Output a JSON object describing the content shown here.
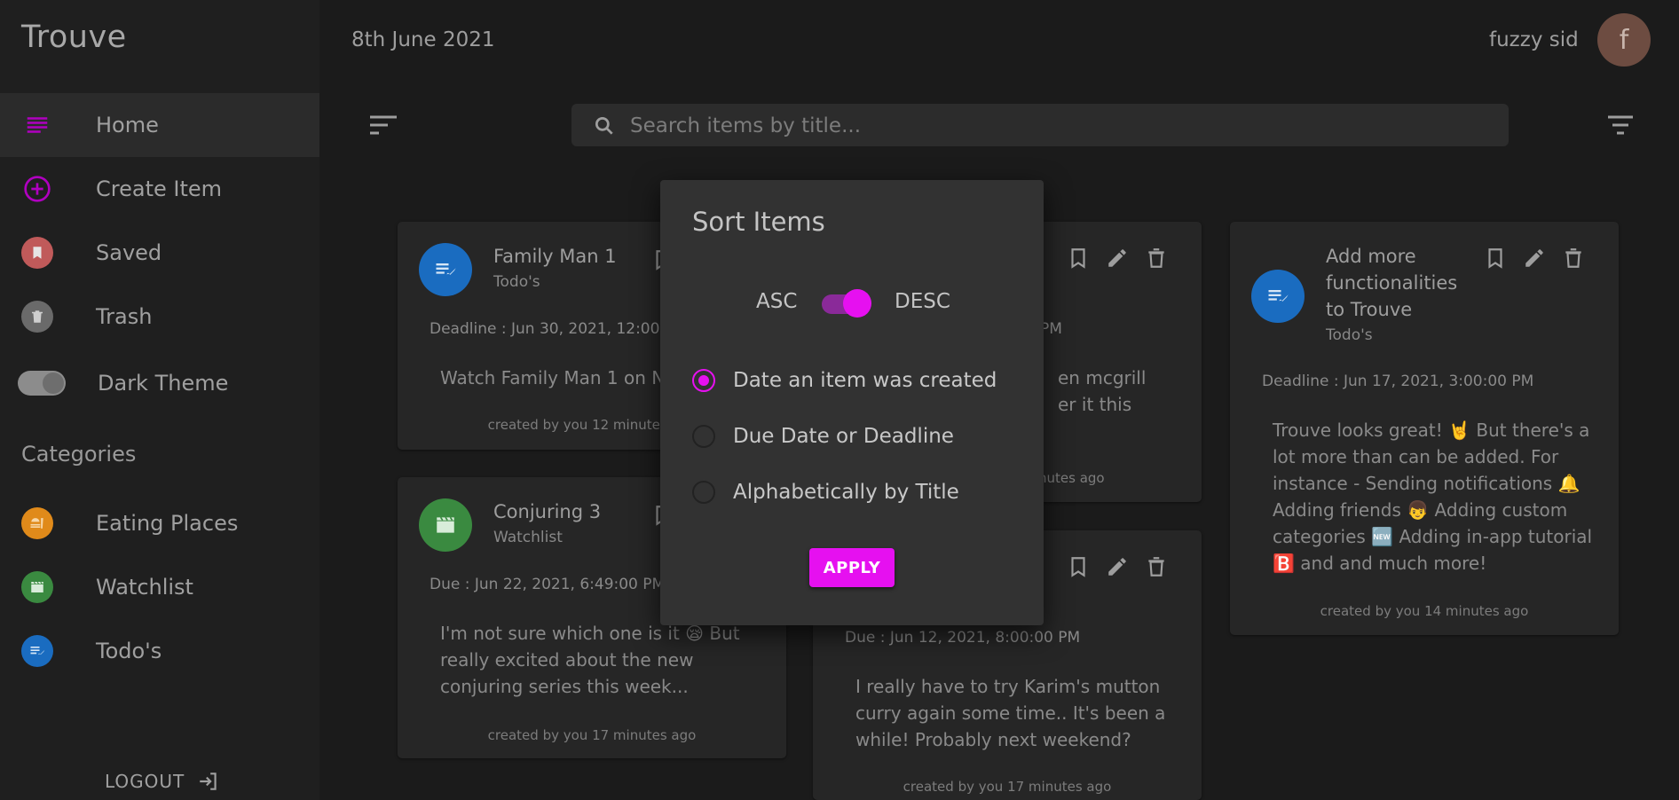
{
  "app": {
    "title": "Trouve"
  },
  "header": {
    "date": "8th June 2021",
    "username": "fuzzy sid",
    "avatar_letter": "f"
  },
  "sidebar": {
    "items": [
      {
        "label": "Home",
        "icon": "list-icon",
        "color": "#b000c0"
      },
      {
        "label": "Create Item",
        "icon": "add-circle-icon",
        "color": "#b000c0"
      },
      {
        "label": "Saved",
        "icon": "bookmark-icon",
        "color": "#c05a5a"
      },
      {
        "label": "Trash",
        "icon": "trash-icon",
        "color": "#6a6a6a"
      }
    ],
    "theme_label": "Dark Theme",
    "categories_heading": "Categories",
    "categories": [
      {
        "label": "Eating Places",
        "icon": "fastfood-icon",
        "color": "#e08a1a"
      },
      {
        "label": "Watchlist",
        "icon": "clapperboard-icon",
        "color": "#3a8a40"
      },
      {
        "label": "Todo's",
        "icon": "checklist-icon",
        "color": "#1a6cc0"
      }
    ],
    "logout_label": "LOGOUT"
  },
  "search": {
    "placeholder": "Search items by title..."
  },
  "cards": [
    {
      "title": "Family Man 1",
      "category": "Todo's",
      "deadline": "Deadline : Jun 30, 2021, 12:00:00 AM",
      "body": "Watch Family Man 1 on Netflix",
      "created": "created by you 12 minutes ago"
    },
    {
      "title": "Conjuring 3",
      "category": "Watchlist",
      "deadline": "Due : Jun 22, 2021, 6:49:00 PM",
      "body": "I'm not sure which one is it 😪 But really excited about the new conjuring series this week...",
      "created": "created by you 17 minutes ago"
    },
    {
      "deadline_tail": "PM",
      "body_line1": "en mcgrill",
      "body_line2": "er it this",
      "created_tail": "nutes ago"
    },
    {
      "deadline": "Due : Jun 12, 2021, 8:00:00 PM",
      "body": "I really have to try Karim's mutton curry again some time.. It's been a while! Probably next weekend?",
      "created": "created by you 17 minutes ago"
    },
    {
      "title": "Add more functionalities to Trouve",
      "category": "Todo's",
      "deadline": "Deadline : Jun 17, 2021, 3:00:00 PM",
      "body": "Trouve looks great! 🤘 But there's a lot more than can be added. For instance - Sending notifications 🔔 Adding friends 👦 Adding custom categories 🆕 Adding in-app tutorial 🅱️ and and much more!",
      "created": "created by you 14 minutes ago"
    }
  ],
  "sort_dialog": {
    "title": "Sort Items",
    "asc_label": "ASC",
    "desc_label": "DESC",
    "desc_enabled": true,
    "options": [
      {
        "label": "Date an item was created",
        "selected": true
      },
      {
        "label": "Due Date or Deadline",
        "selected": false
      },
      {
        "label": "Alphabetically by Title",
        "selected": false
      }
    ],
    "apply_label": "APPLY"
  },
  "colors": {
    "accent": "#e610f0",
    "background": "#1b1b1b",
    "card": "#262626",
    "dialog": "#323232"
  }
}
